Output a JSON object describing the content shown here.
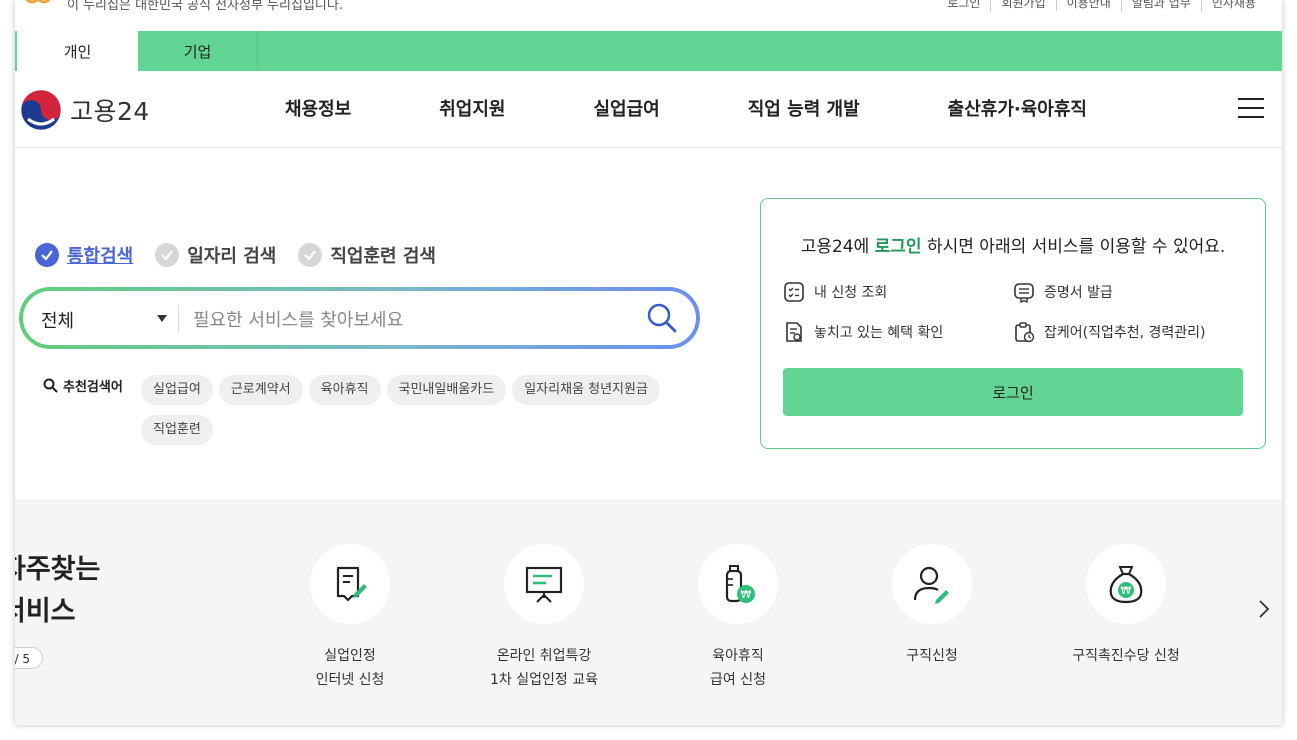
{
  "topbar": {
    "notice": "이 누리집은 대한민국 공식 전자정부 누리집입니다.",
    "util_links": [
      "로그인",
      "회원가입",
      "이용안내",
      "알림과 업무",
      "인사채용"
    ]
  },
  "tabs": [
    "개인",
    "기업"
  ],
  "brand": {
    "name": "고용24"
  },
  "gnb": [
    "채용정보",
    "취업지원",
    "실업급여",
    "직업 능력 개발",
    "출산휴가·육아휴직"
  ],
  "search": {
    "types": [
      "통합검색",
      "일자리 검색",
      "직업훈련 검색"
    ],
    "select_value": "전체",
    "placeholder": "필요한 서비스를 찾아보세요",
    "recommend_label": "추천검색어",
    "chips": [
      "실업급여",
      "근로계약서",
      "육아휴직",
      "국민내일배움카드",
      "일자리채움 청년지원금",
      "직업훈련"
    ]
  },
  "login_card": {
    "title_pre": "고용24에 ",
    "title_hl": "로그인",
    "title_post": " 하시면 아래의 서비스를 이용할 수 있어요.",
    "services": [
      "내 신청 조회",
      "증명서 발급",
      "놓치고 있는 혜택 확인",
      "잡케어(직업추천, 경력관리)"
    ],
    "button": "로그인"
  },
  "frequent": {
    "title_line1": "자주찾는",
    "title_line2": "서비스",
    "pager": "/ 5",
    "items": [
      {
        "line1": "실업인정",
        "line2": "인터넷 신청",
        "icon": "document-pen-icon"
      },
      {
        "line1": "온라인 취업특강",
        "line2": "1차 실업인정 교육",
        "icon": "presentation-board-icon"
      },
      {
        "line1": "육아휴직",
        "line2": "급여 신청",
        "icon": "baby-bottle-won-icon"
      },
      {
        "line1": "구직신청",
        "line2": "",
        "icon": "person-pen-icon"
      },
      {
        "line1": "구직촉진수당 신청",
        "line2": "",
        "icon": "money-bag-icon"
      }
    ]
  },
  "colors": {
    "accent_green": "#62d494",
    "accent_blue": "#4866d6",
    "highlight_green": "#1f9a55"
  }
}
